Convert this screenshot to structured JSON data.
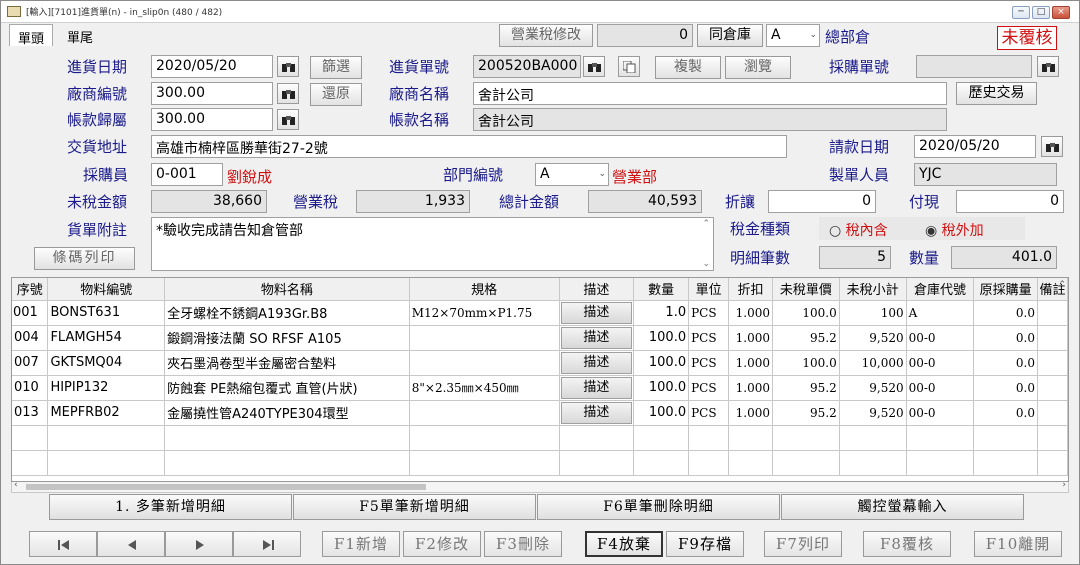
{
  "window": {
    "title": "[輸入][7101]進貨單(n) - in_slip0n   (480 / 482)",
    "controls": [
      "─",
      "□",
      "×"
    ]
  },
  "tabs": [
    "單頭",
    "單尾"
  ],
  "topbar": {
    "tax_edit_btn": "營業稅修改",
    "counter": "0",
    "warehouse_btn": "同倉庫",
    "warehouse_code": "A",
    "warehouse_name": "總部倉",
    "status": "未覆核"
  },
  "form": {
    "date_label": "進貨日期",
    "date": "2020/05/20",
    "filter_btn": "篩選",
    "vendor_code_label": "廠商編號",
    "vendor_code": "300.00",
    "restore_btn": "還原",
    "account_label": "帳款歸屬",
    "account": "300.00",
    "address_label": "交貨地址",
    "address": "高雄市楠梓區勝華街27-2號",
    "buyer_label": "採購員",
    "buyer_code": "0-001",
    "buyer_name": "劉銳成",
    "pretax_label": "未稅金額",
    "pretax": "38,660",
    "note_label": "貨單附註",
    "note": "*驗收完成請告知倉管部",
    "barcode_btn": "條碼列印",
    "slip_no_label": "進貨單號",
    "slip_no": "200520BA000",
    "copy_btn": "複製",
    "browse_btn": "瀏覽",
    "vendor_name_label": "廠商名稱",
    "vendor_name": "舍計公司",
    "account_name_label": "帳款名稱",
    "account_name": "舍計公司",
    "dept_label": "部門編號",
    "dept_code": "A",
    "dept_name": "營業部",
    "tax_label": "營業稅",
    "tax": "1,933",
    "total_label": "總計金額",
    "total": "40,593",
    "discount_label": "折讓",
    "discount": "0",
    "cash_label": "付現",
    "cash": "0",
    "po_label": "採購單號",
    "po": "",
    "history_btn": "歷史交易",
    "invoice_date_label": "請款日期",
    "invoice_date": "2020/05/20",
    "creator_label": "製單人員",
    "creator": "YJC",
    "tax_type_label": "稅金種類",
    "tax_incl": "稅內含",
    "tax_excl": "稅外加",
    "line_count_label": "明細筆數",
    "line_count": "5",
    "qty_label": "數量",
    "qty": "401.0"
  },
  "table": {
    "headers": [
      "序號",
      "物料編號",
      "物料名稱",
      "規格",
      "描述",
      "數量",
      "單位",
      "折扣",
      "未稅單價",
      "未稅小計",
      "倉庫代號",
      "原採購量",
      "備註"
    ],
    "rows": [
      {
        "seq": "001",
        "code": "BONST631",
        "name": "全牙螺栓不銹鋼A193Gr.B8",
        "spec": "M12×70mm×P1.75",
        "desc": "描述",
        "qty": "1.0",
        "unit": "PCS",
        "disc": "1.000",
        "price": "100.0",
        "subtotal": "100",
        "wh": "A",
        "orig": "0.0"
      },
      {
        "seq": "004",
        "code": "FLAMGH54",
        "name": "鍛鋼滑接法蘭 SO RFSF A105",
        "spec": "",
        "desc": "描述",
        "qty": "100.0",
        "unit": "PCS",
        "disc": "1.000",
        "price": "95.2",
        "subtotal": "9,520",
        "wh": "00-0",
        "orig": "0.0"
      },
      {
        "seq": "007",
        "code": "GKTSMQ04",
        "name": "夾石墨渦卷型半金屬密合墊料",
        "spec": "",
        "desc": "描述",
        "qty": "100.0",
        "unit": "PCS",
        "disc": "1.000",
        "price": "100.0",
        "subtotal": "10,000",
        "wh": "00-0",
        "orig": "0.0"
      },
      {
        "seq": "010",
        "code": "HIPIP132",
        "name": "防蝕套 PE熱縮包覆式 直管(片狀)",
        "spec": "8\"×2.35㎜×450㎜",
        "desc": "描述",
        "qty": "100.0",
        "unit": "PCS",
        "disc": "1.000",
        "price": "95.2",
        "subtotal": "9,520",
        "wh": "00-0",
        "orig": "0.0"
      },
      {
        "seq": "013",
        "code": "MEPFRB02",
        "name": "金屬撓性管A240TYPE304環型",
        "spec": "",
        "desc": "描述",
        "qty": "100.0",
        "unit": "PCS",
        "disc": "1.000",
        "price": "95.2",
        "subtotal": "9,520",
        "wh": "00-0",
        "orig": "0.0"
      }
    ]
  },
  "detail_buttons": {
    "multi_add": "1. 多筆新增明細",
    "single_add": "F5單筆新增明細",
    "single_delete": "F6單筆刪除明細",
    "touch_input": "觸控螢幕輸入"
  },
  "function_keys": {
    "add": "F1新增",
    "edit": "F2修改",
    "delete": "F3刪除",
    "abandon": "F4放棄",
    "save": "F9存檔",
    "print": "F7列印",
    "review": "F8覆核",
    "exit": "F10離開"
  }
}
